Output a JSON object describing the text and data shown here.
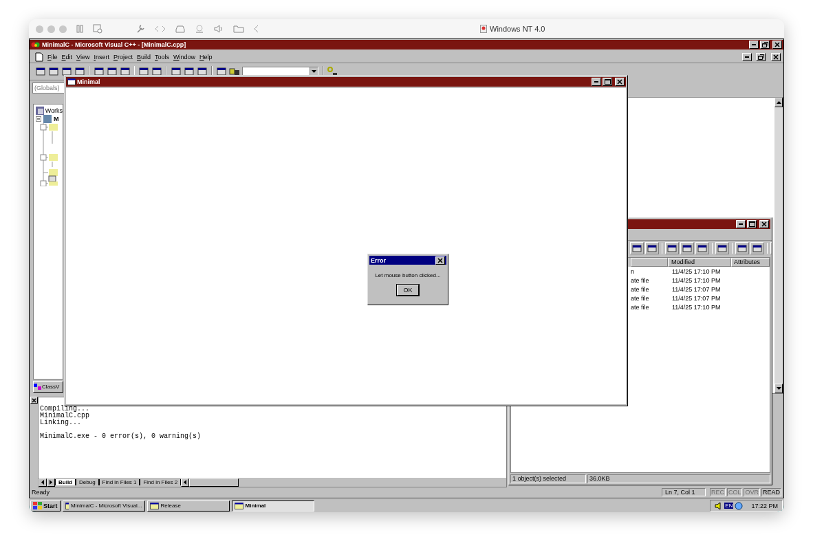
{
  "host": {
    "title": "Windows NT 4.0"
  },
  "ide": {
    "title": "MinimalC - Microsoft Visual C++ - [MinimalC.cpp]",
    "menu": [
      "File",
      "Edit",
      "View",
      "Insert",
      "Project",
      "Build",
      "Tools",
      "Window",
      "Help"
    ],
    "scope": "(Globals)",
    "workspace": {
      "root": "Works",
      "project": "M",
      "tab": "ClassV"
    },
    "output": {
      "lines": [
        {
          "text": "Compiling...",
          "gap_before": false
        },
        {
          "text": "MinimalC.cpp",
          "gap_before": false
        },
        {
          "text": "Linking...",
          "gap_before": false
        },
        {
          "text": "MinimalC.exe - 0 error(s), 0 warning(s)",
          "gap_before": true
        }
      ],
      "tabs": [
        {
          "label": "Build",
          "selected": true
        },
        {
          "label": "Debug",
          "selected": false
        },
        {
          "label": "Find in Files 1",
          "selected": false
        },
        {
          "label": "Find in Files 2",
          "selected": false
        }
      ]
    },
    "status": {
      "message": "Ready",
      "position": "Ln 7, Col 1",
      "indicators": [
        {
          "label": "REC",
          "on": false
        },
        {
          "label": "COL",
          "on": false
        },
        {
          "label": "OVR",
          "on": false
        },
        {
          "label": "READ",
          "on": true
        }
      ]
    }
  },
  "explorer": {
    "columns": [
      "Modified",
      "Attributes"
    ],
    "rows": [
      {
        "name": "n",
        "modified": "11/4/25 17:10 PM"
      },
      {
        "name": "ate file",
        "modified": "11/4/25 17:10 PM"
      },
      {
        "name": "ate file",
        "modified": "11/4/25 17:07 PM"
      },
      {
        "name": "ate file",
        "modified": "11/4/25 17:07 PM"
      },
      {
        "name": "ate file",
        "modified": "11/4/25 17:10 PM"
      }
    ],
    "status": [
      "1 object(s) selected",
      "36.0KB"
    ]
  },
  "app": {
    "title": "Minimal"
  },
  "dialog": {
    "title": "Error",
    "message": "Let mouse button clicked...",
    "button": "OK"
  },
  "taskbar": {
    "start": "Start",
    "tasks": [
      {
        "label": "MinimalC - Microsoft Visual...",
        "selected": false
      },
      {
        "label": "Release",
        "selected": false
      },
      {
        "label": "Minimal",
        "selected": true
      }
    ],
    "language": "EN",
    "clock": "17:22 PM"
  }
}
